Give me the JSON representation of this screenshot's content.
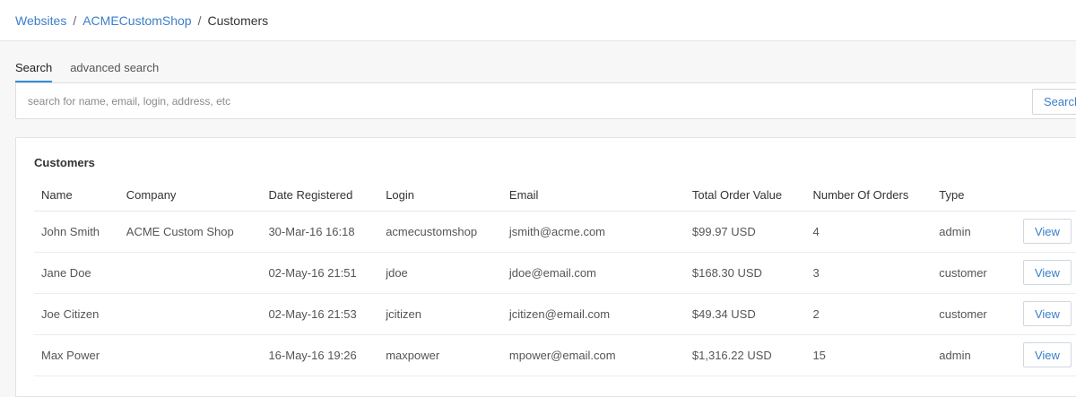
{
  "breadcrumb": {
    "items": [
      "Websites",
      "ACMECustomShop"
    ],
    "separator": "/",
    "current": "Customers"
  },
  "tabs": [
    {
      "label": "Search",
      "active": true
    },
    {
      "label": "advanced search",
      "active": false
    }
  ],
  "search": {
    "placeholder": "search for name, email, login, address, etc",
    "value": "",
    "button_label": "Search"
  },
  "customers_panel": {
    "title": "Customers",
    "columns": [
      "Name",
      "Company",
      "Date Registered",
      "Login",
      "Email",
      "Total Order Value",
      "Number Of Orders",
      "Type"
    ],
    "rows": [
      {
        "name": "John Smith",
        "company": "ACME Custom Shop",
        "date": "30-Mar-16 16:18",
        "login": "acmecustomshop",
        "email": "jsmith@acme.com",
        "total": "$99.97 USD",
        "orders": "4",
        "type": "admin",
        "action": "View"
      },
      {
        "name": "Jane Doe",
        "company": "",
        "date": "02-May-16 21:51",
        "login": "jdoe",
        "email": "jdoe@email.com",
        "total": "$168.30 USD",
        "orders": "3",
        "type": "customer",
        "action": "View"
      },
      {
        "name": "Joe Citizen",
        "company": "",
        "date": "02-May-16 21:53",
        "login": "jcitizen",
        "email": "jcitizen@email.com",
        "total": "$49.34 USD",
        "orders": "2",
        "type": "customer",
        "action": "View"
      },
      {
        "name": "Max Power",
        "company": "",
        "date": "16-May-16 19:26",
        "login": "maxpower",
        "email": "mpower@email.com",
        "total": "$1,316.22 USD",
        "orders": "15",
        "type": "admin",
        "action": "View"
      }
    ]
  },
  "colors": {
    "link": "#3a7fc9",
    "tab_active_underline": "#2f8fd8",
    "page_bg": "#f7f7f7"
  }
}
